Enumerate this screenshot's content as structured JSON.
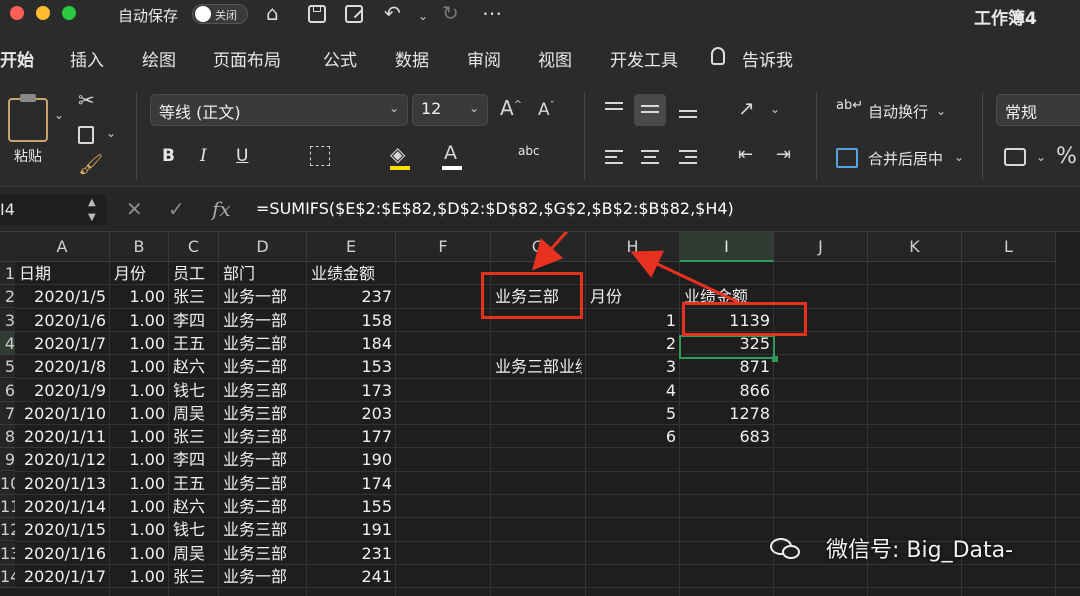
{
  "titlebar": {
    "autosave_label": "自动保存",
    "toggle_label": "关闭",
    "workbook_title": "工作簿4"
  },
  "tabs": [
    "开始",
    "插入",
    "绘图",
    "页面布局",
    "公式",
    "数据",
    "审阅",
    "视图",
    "开发工具",
    "告诉我"
  ],
  "ribbon": {
    "paste_label": "粘贴",
    "font_name": "等线 (正文)",
    "font_size": "12",
    "bold": "B",
    "italic": "I",
    "underline": "U",
    "wrap_text": "自动换行",
    "merge_center": "合并后居中",
    "number_format": "常规"
  },
  "formula_bar": {
    "name_box": "I4",
    "formula": "=SUMIFS($E$2:$E$82,$D$2:$D$82,$G$2,$B$2:$B$82,$H4)"
  },
  "sheet": {
    "columns": [
      "A",
      "B",
      "C",
      "D",
      "E",
      "F",
      "G",
      "H",
      "I",
      "J",
      "K",
      "L"
    ],
    "selected_column": "I",
    "row_numbers": [
      "1",
      "2",
      "3",
      "4",
      "5",
      "6",
      "7",
      "8",
      "9",
      "10",
      "11",
      "12",
      "13",
      "14"
    ],
    "headers": [
      "日期",
      "月份",
      "员工",
      "部门",
      "业绩金额"
    ],
    "rows": [
      [
        "2020/1/5",
        "1.00",
        "张三",
        "业务一部",
        "237"
      ],
      [
        "2020/1/6",
        "1.00",
        "李四",
        "业务一部",
        "158"
      ],
      [
        "2020/1/7",
        "1.00",
        "王五",
        "业务二部",
        "184"
      ],
      [
        "2020/1/8",
        "1.00",
        "赵六",
        "业务二部",
        "153"
      ],
      [
        "2020/1/9",
        "1.00",
        "钱七",
        "业务三部",
        "173"
      ],
      [
        "2020/1/10",
        "1.00",
        "周吴",
        "业务三部",
        "203"
      ],
      [
        "2020/1/11",
        "1.00",
        "张三",
        "业务三部",
        "177"
      ],
      [
        "2020/1/12",
        "1.00",
        "李四",
        "业务一部",
        "190"
      ],
      [
        "2020/1/13",
        "1.00",
        "王五",
        "业务二部",
        "174"
      ],
      [
        "2020/1/14",
        "1.00",
        "赵六",
        "业务二部",
        "155"
      ],
      [
        "2020/1/15",
        "1.00",
        "钱七",
        "业务三部",
        "191"
      ],
      [
        "2020/1/16",
        "1.00",
        "周吴",
        "业务三部",
        "231"
      ],
      [
        "2020/1/17",
        "1.00",
        "张三",
        "业务一部",
        "241"
      ]
    ],
    "g2": "业务三部",
    "h2": "月份",
    "i2": "业绩金额",
    "g5": "业务三部业绩",
    "months": [
      "1",
      "2",
      "3",
      "4",
      "5",
      "6"
    ],
    "totals": [
      "1139",
      "325",
      "871",
      "866",
      "1278",
      "683"
    ]
  },
  "watermark": "微信号: Big_Data-",
  "colors": {
    "annotation": "#e8321f",
    "selection": "#2e9a5b"
  }
}
